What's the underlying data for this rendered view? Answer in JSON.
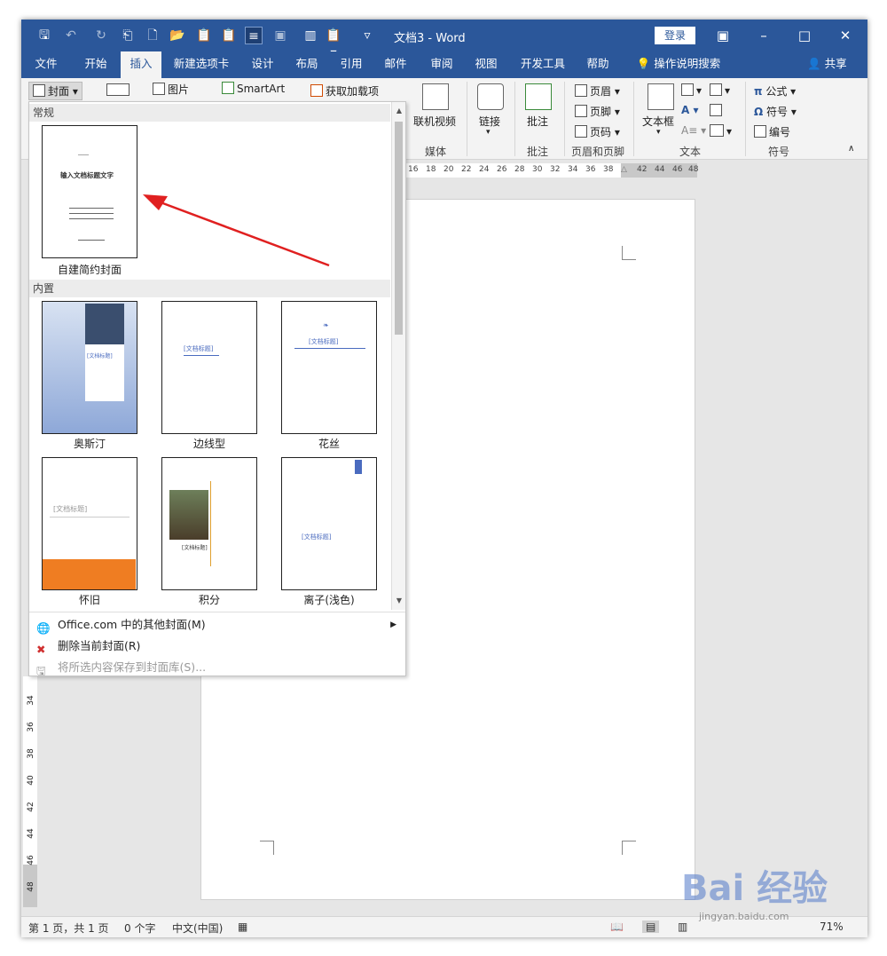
{
  "title_bar": {
    "doc_title": "文档3  -  Word",
    "login": "登录",
    "colors": {
      "accent": "#2b579a"
    }
  },
  "tabs": [
    "文件",
    "开始",
    "插入",
    "新建选项卡",
    "设计",
    "布局",
    "引用",
    "邮件",
    "审阅",
    "视图",
    "开发工具",
    "帮助"
  ],
  "active_tab": "插入",
  "tell_me": "操作说明搜索",
  "share": "共享",
  "ribbon": {
    "cover": "封面",
    "picture": "图片",
    "smartart": "SmartArt",
    "addins": "获取加载项",
    "online_video": "联机视频",
    "media_group": "媒体",
    "link": "链接",
    "comment": "批注",
    "comment_group": "批注",
    "header": "页眉",
    "footer": "页脚",
    "page_number": "页码",
    "header_footer_group": "页眉和页脚",
    "textbox": "文本框",
    "text_group": "文本",
    "equation": "公式",
    "symbol": "符号",
    "numbering": "编号",
    "symbols_group": "符号"
  },
  "ruler": {
    "h_ticks": [
      "16",
      "18",
      "20",
      "22",
      "24",
      "26",
      "28",
      "30",
      "32",
      "34",
      "36",
      "38",
      "42",
      "44",
      "46",
      "48"
    ],
    "v_ticks": [
      "34",
      "36",
      "38",
      "40",
      "42",
      "44",
      "46",
      "48"
    ]
  },
  "cover_gallery": {
    "section_general": "常规",
    "section_builtin": "内置",
    "general_items": [
      {
        "label": "自建简约封面",
        "lines": [
          "输入文档标题文字"
        ]
      }
    ],
    "builtin_items": [
      {
        "label": "奥斯汀",
        "title": "[文档标题]"
      },
      {
        "label": "边线型",
        "title": "[文档标题]"
      },
      {
        "label": "花丝",
        "title": "[文档标题]"
      },
      {
        "label": "怀旧",
        "title": "[文档标题]"
      },
      {
        "label": "积分",
        "title": "[文档标题]"
      },
      {
        "label": "离子(浅色)",
        "title": "[文档标题]"
      }
    ]
  },
  "menu": [
    {
      "label": "Office.com 中的其他封面(M)",
      "enabled": true,
      "icon": "globe-icon"
    },
    {
      "label": "删除当前封面(R)",
      "enabled": true,
      "icon": "delete-icon"
    },
    {
      "label": "将所选内容保存到封面库(S)...",
      "enabled": false,
      "icon": "save-icon"
    }
  ],
  "status": {
    "page": "第 1 页，共 1 页",
    "words": "0 个字",
    "lang": "中文(中国)",
    "zoom": "71%"
  },
  "watermark": {
    "text": "Bai 经验",
    "url": "jingyan.baidu.com"
  }
}
